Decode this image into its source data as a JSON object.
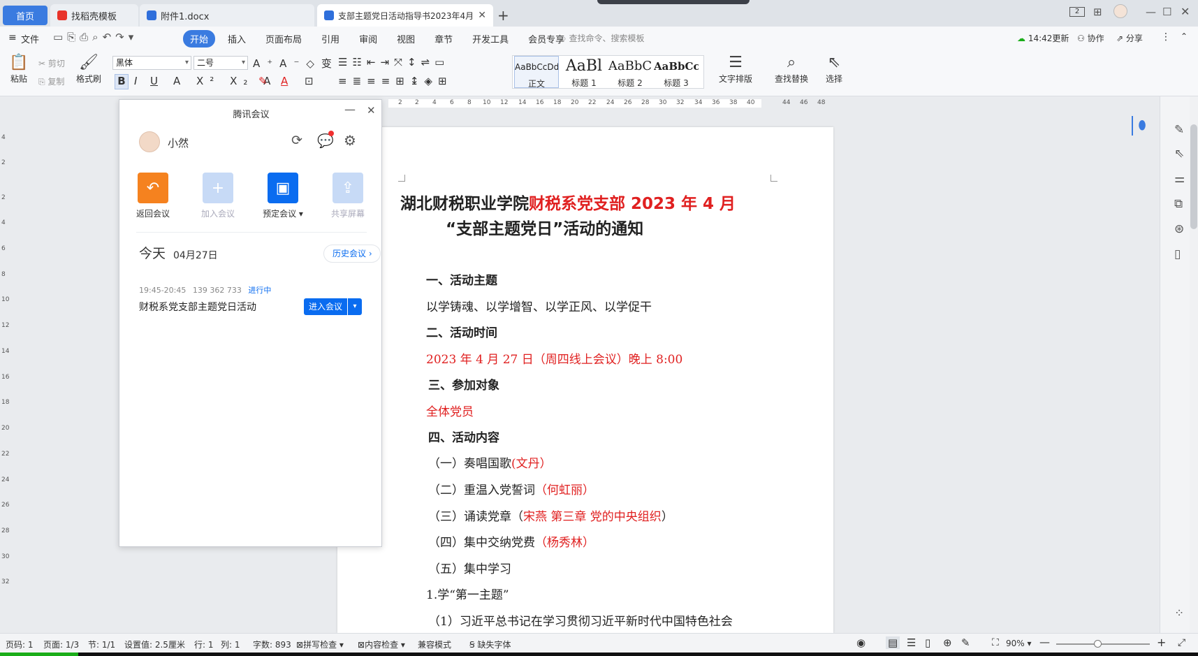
{
  "tabs": [
    {
      "label": "首页"
    },
    {
      "label": "找稻壳模板"
    },
    {
      "label": "附件1.docx"
    },
    {
      "label": "支部主题党日活动指导书2023年4月"
    }
  ],
  "titlebar": {
    "new_tab": "+",
    "badge": "2"
  },
  "menu": {
    "file": "文件",
    "items": [
      "开始",
      "插入",
      "页面布局",
      "引用",
      "审阅",
      "视图",
      "章节",
      "开发工具",
      "会员专享"
    ],
    "search_placeholder": "查找命令、搜索模板",
    "update": "14:42更新",
    "collab": "协作",
    "share": "分享"
  },
  "ribbon": {
    "paste": "粘贴",
    "cut": "剪切",
    "copy": "复制",
    "format_painter": "格式刷",
    "font": "黑体",
    "size": "二号",
    "styles": [
      {
        "preview": "AaBbCcDd",
        "label": "正文"
      },
      {
        "preview": "AaBl",
        "label": "标题 1"
      },
      {
        "preview": "AaBbC",
        "label": "标题 2"
      },
      {
        "preview": "AaBbCcI",
        "label": "标题 3"
      }
    ],
    "text_layout": "文字排版",
    "find_replace": "查找替换",
    "select": "选择"
  },
  "ruler": {
    "h": [
      "2",
      "2",
      "4",
      "6",
      "8",
      "10",
      "12",
      "14",
      "16",
      "18",
      "20",
      "22",
      "24",
      "26",
      "28",
      "30",
      "32",
      "34",
      "36",
      "38",
      "40",
      "44",
      "46",
      "48"
    ],
    "v": [
      "4",
      "2",
      "2",
      "4",
      "6",
      "8",
      "10",
      "12",
      "14",
      "16",
      "18",
      "20",
      "22",
      "24",
      "26",
      "28",
      "30",
      "32"
    ]
  },
  "meeting": {
    "title": "腾讯会议",
    "user": "小然",
    "buttons": [
      "返回会议",
      "加入会议",
      "预定会议",
      "共享屏幕"
    ],
    "today": "今天",
    "date": "04月27日",
    "history": "历史会议",
    "item": {
      "time": "19:45-20:45",
      "id": "139 362 733",
      "status": "进行中",
      "name": "财税系党支部主题党日活动",
      "enter": "进入会议"
    }
  },
  "doc": {
    "title1_black": "湖北财税职业学院",
    "title1_red": "财税系党支部 2023 年 4 月",
    "title2": "“支部主题党日”活动的通知",
    "h1": "一、活动主题",
    "p1": "以学铸魂、以学增智、以学正风、以学促干",
    "h2": "二、活动时间",
    "p2": "2023 年 4 月 27 日（周四线上会议）晚上 8:00",
    "h3": "三、参加对象",
    "p3": "全体党员",
    "h4": "四、活动内容",
    "c1a": "（一）奏唱国歌",
    "c1b": "(文丹）",
    "c2a": "（二）重温入党誓词",
    "c2b": "（何虹丽）",
    "c3a": "（三）诵读党章（",
    "c3b": "宋燕  第三章  党的中央组织",
    "c3c": "）",
    "c4a": "（四）集中交纳党费",
    "c4b": "（杨秀林）",
    "c5": "（五）集中学习",
    "c6": "1.学“第一主题”",
    "c7": "（1）习近平总书记在学习贯彻习近平新时代中国特色社会"
  },
  "status": {
    "page": "页码: 1",
    "pages": "页面: 1/3",
    "section": "节: 1/1",
    "setting": "设置值: 2.5厘米",
    "row": "行: 1",
    "col": "列: 1",
    "words": "字数: 893",
    "spell": "拼写检查",
    "content": "内容检查",
    "compat": "兼容模式",
    "missing_font": "缺失字体",
    "zoom": "90%"
  },
  "colors": {
    "accent": "#3a7be0",
    "red": "#e02020",
    "meet_blue": "#0a6cf0"
  }
}
